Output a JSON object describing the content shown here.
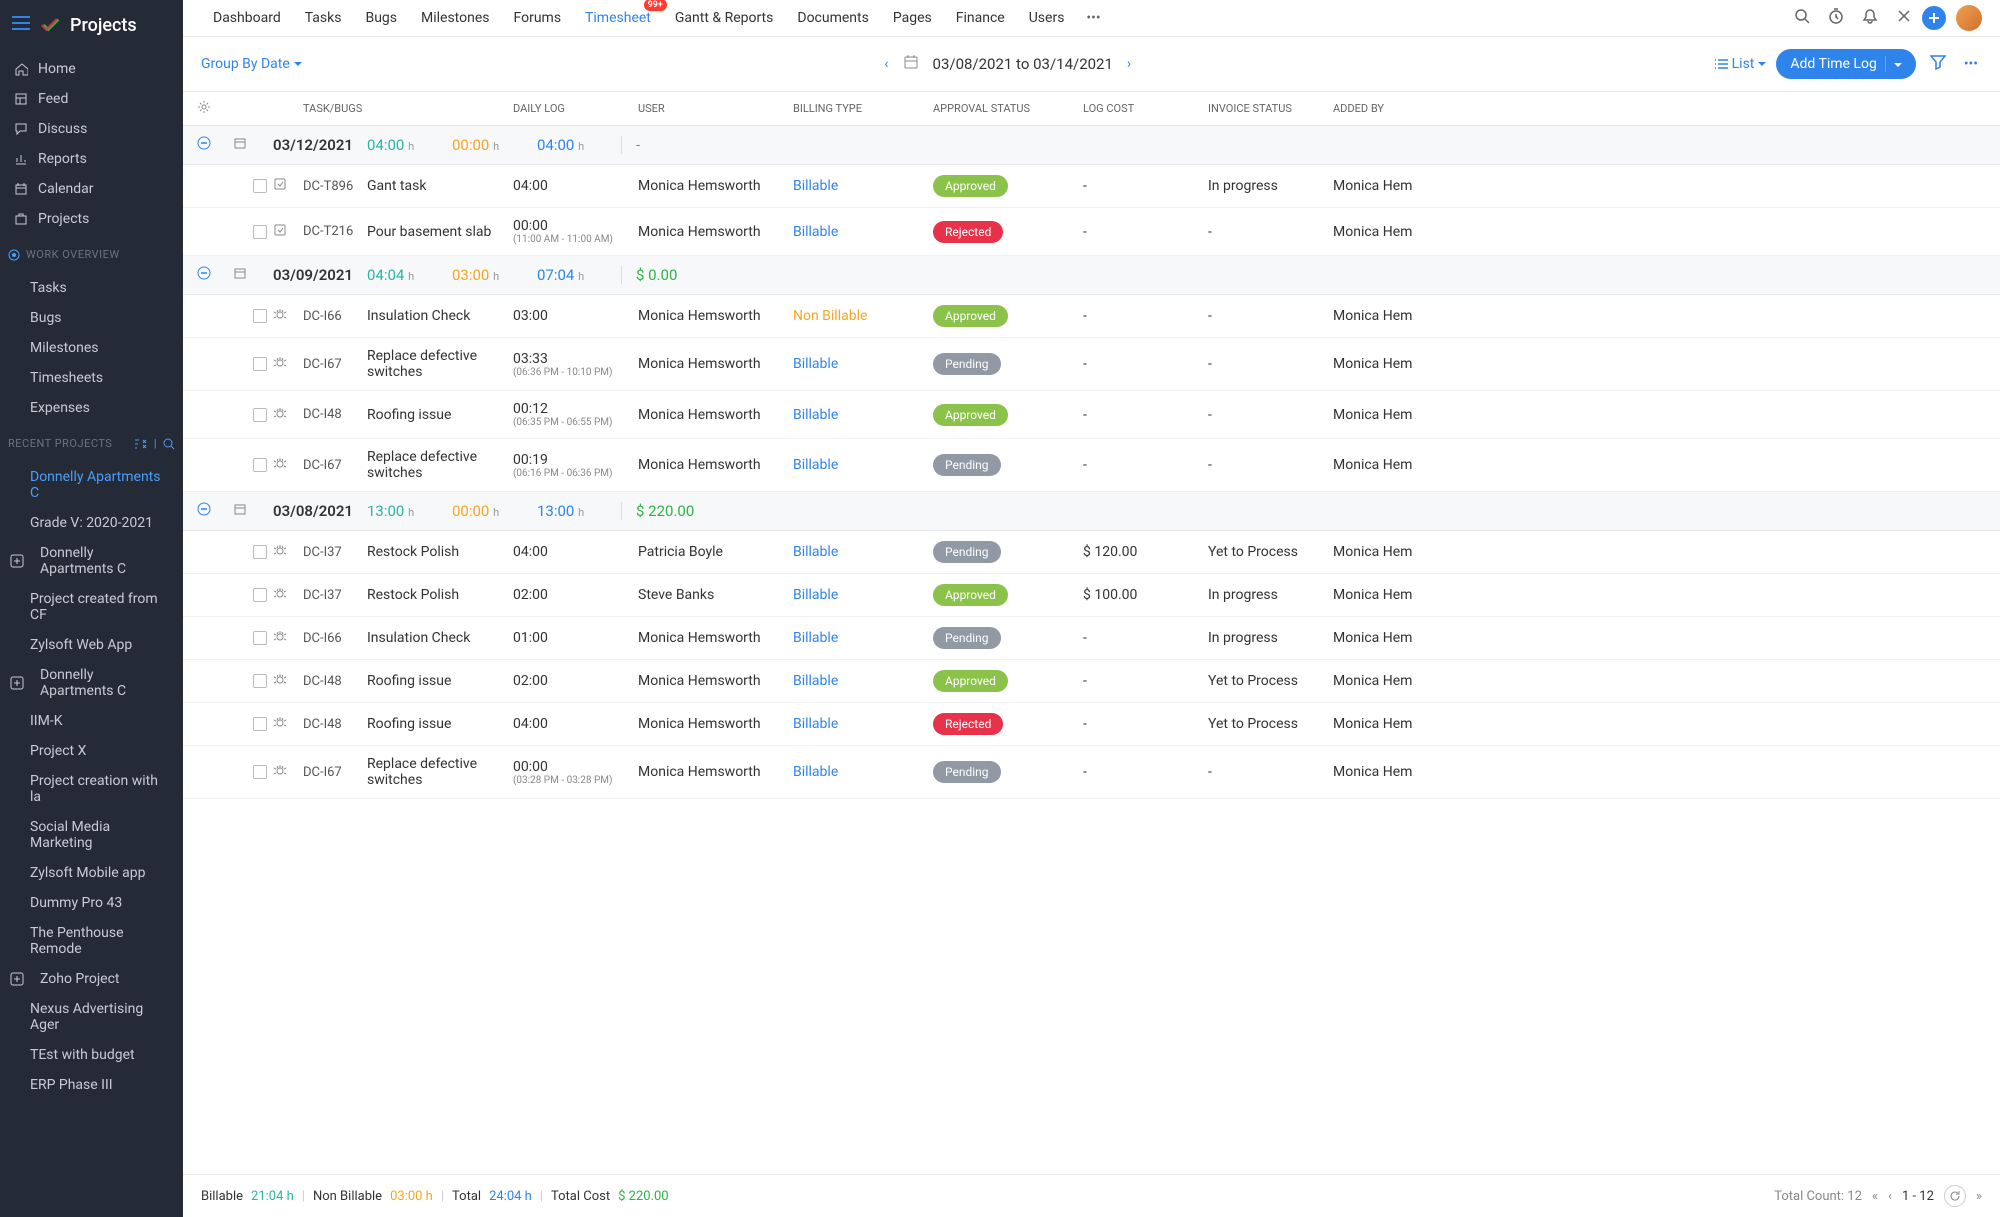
{
  "app_name": "Projects",
  "sidebar": {
    "main_items": [
      {
        "icon": "home",
        "label": "Home"
      },
      {
        "icon": "feed",
        "label": "Feed"
      },
      {
        "icon": "discuss",
        "label": "Discuss"
      },
      {
        "icon": "reports",
        "label": "Reports"
      },
      {
        "icon": "calendar",
        "label": "Calendar"
      },
      {
        "icon": "projects",
        "label": "Projects"
      }
    ],
    "work_overview_label": "WORK OVERVIEW",
    "work_items": [
      "Tasks",
      "Bugs",
      "Milestones",
      "Timesheets",
      "Expenses"
    ],
    "recent_projects_label": "RECENT PROJECTS",
    "recent_items": [
      {
        "label": "Donnelly Apartments C",
        "active": true
      },
      {
        "label": "Grade V: 2020-2021"
      },
      {
        "label": "Donnelly Apartments C",
        "icon": true
      },
      {
        "label": "Project created from CF"
      },
      {
        "label": "Zylsoft Web App"
      },
      {
        "label": "Donnelly Apartments C",
        "icon": true
      },
      {
        "label": "IIM-K"
      },
      {
        "label": "Project X"
      },
      {
        "label": "Project creation with la"
      },
      {
        "label": "Social Media Marketing"
      },
      {
        "label": "Zylsoft Mobile app"
      },
      {
        "label": "Dummy Pro 43"
      },
      {
        "label": "The Penthouse Remode"
      },
      {
        "label": "Zoho Project",
        "icon": true
      },
      {
        "label": "Nexus Advertising Ager"
      },
      {
        "label": "TEst with budget"
      },
      {
        "label": "ERP Phase III"
      }
    ]
  },
  "topbar": {
    "tabs": [
      "Dashboard",
      "Tasks",
      "Bugs",
      "Milestones",
      "Forums",
      "Timesheet",
      "Gantt & Reports",
      "Documents",
      "Pages",
      "Finance",
      "Users"
    ],
    "active": "Timesheet",
    "badge": "99+"
  },
  "toolbar": {
    "group_by": "Group By Date",
    "date_range": "03/08/2021 to 03/14/2021",
    "view_label": "List",
    "add_label": "Add Time Log"
  },
  "columns": [
    "TASK/BUGS",
    "DAILY LOG",
    "USER",
    "BILLING TYPE",
    "APPROVAL STATUS",
    "LOG COST",
    "INVOICE STATUS",
    "ADDED BY"
  ],
  "groups": [
    {
      "date": "03/12/2021",
      "h1": "04:00",
      "h2": "00:00",
      "h3": "04:00",
      "cost": "-",
      "rows": [
        {
          "type": "task",
          "id": "DC-T896",
          "name": "Gant task",
          "daily": "04:00",
          "user": "Monica Hemsworth",
          "billing": "Billable",
          "approval": "Approved",
          "logcost": "-",
          "invoice": "In progress",
          "added": "Monica Hem"
        },
        {
          "type": "task",
          "id": "DC-T216",
          "name": "Pour basement slab",
          "daily": "00:00",
          "span": "(11:00 AM - 11:00 AM)",
          "user": "Monica Hemsworth",
          "billing": "Billable",
          "approval": "Rejected",
          "logcost": "-",
          "invoice": "-",
          "added": "Monica Hem"
        }
      ]
    },
    {
      "date": "03/09/2021",
      "h1": "04:04",
      "h2": "03:00",
      "h3": "07:04",
      "cost": "$ 0.00",
      "rows": [
        {
          "type": "bug",
          "id": "DC-I66",
          "name": "Insulation Check",
          "daily": "03:00",
          "user": "Monica Hemsworth",
          "billing": "Non Billable",
          "approval": "Approved",
          "logcost": "-",
          "invoice": "-",
          "added": "Monica Hem"
        },
        {
          "type": "bug",
          "id": "DC-I67",
          "name": "Replace defective switches",
          "daily": "03:33",
          "span": "(06:36 PM - 10:10 PM)",
          "user": "Monica Hemsworth",
          "billing": "Billable",
          "approval": "Pending",
          "logcost": "-",
          "invoice": "-",
          "added": "Monica Hem"
        },
        {
          "type": "bug",
          "id": "DC-I48",
          "name": "Roofing issue",
          "daily": "00:12",
          "span": "(06:35 PM - 06:55 PM)",
          "user": "Monica Hemsworth",
          "billing": "Billable",
          "approval": "Approved",
          "logcost": "-",
          "invoice": "-",
          "added": "Monica Hem"
        },
        {
          "type": "bug",
          "id": "DC-I67",
          "name": "Replace defective switches",
          "daily": "00:19",
          "span": "(06:16 PM - 06:36 PM)",
          "user": "Monica Hemsworth",
          "billing": "Billable",
          "approval": "Pending",
          "logcost": "-",
          "invoice": "-",
          "added": "Monica Hem"
        }
      ]
    },
    {
      "date": "03/08/2021",
      "h1": "13:00",
      "h2": "00:00",
      "h3": "13:00",
      "cost": "$ 220.00",
      "rows": [
        {
          "type": "bug",
          "id": "DC-I37",
          "name": "Restock Polish",
          "daily": "04:00",
          "user": "Patricia Boyle",
          "billing": "Billable",
          "approval": "Pending",
          "logcost": "$ 120.00",
          "invoice": "Yet to Process",
          "added": "Monica Hem"
        },
        {
          "type": "bug",
          "id": "DC-I37",
          "name": "Restock Polish",
          "daily": "02:00",
          "user": "Steve Banks",
          "billing": "Billable",
          "approval": "Approved",
          "logcost": "$ 100.00",
          "invoice": "In progress",
          "added": "Monica Hem"
        },
        {
          "type": "bug",
          "id": "DC-I66",
          "name": "Insulation Check",
          "daily": "01:00",
          "user": "Monica Hemsworth",
          "billing": "Billable",
          "approval": "Pending",
          "logcost": "-",
          "invoice": "In progress",
          "added": "Monica Hem"
        },
        {
          "type": "bug",
          "id": "DC-I48",
          "name": "Roofing issue",
          "daily": "02:00",
          "user": "Monica Hemsworth",
          "billing": "Billable",
          "approval": "Approved",
          "logcost": "-",
          "invoice": "Yet to Process",
          "added": "Monica Hem"
        },
        {
          "type": "bug",
          "id": "DC-I48",
          "name": "Roofing issue",
          "daily": "04:00",
          "user": "Monica Hemsworth",
          "billing": "Billable",
          "approval": "Rejected",
          "logcost": "-",
          "invoice": "Yet to Process",
          "added": "Monica Hem"
        },
        {
          "type": "bug",
          "id": "DC-I67",
          "name": "Replace defective switches",
          "daily": "00:00",
          "span": "(03:28 PM - 03:28 PM)",
          "user": "Monica Hemsworth",
          "billing": "Billable",
          "approval": "Pending",
          "logcost": "-",
          "invoice": "-",
          "added": "Monica Hem"
        }
      ]
    }
  ],
  "footer": {
    "billable_label": "Billable",
    "billable_val": "21:04 h",
    "nonbillable_label": "Non Billable",
    "nonbillable_val": "03:00 h",
    "total_label": "Total",
    "total_val": "24:04 h",
    "totalcost_label": "Total Cost",
    "totalcost_val": "$ 220.00",
    "count_label": "Total Count: 12",
    "range": "1 - 12"
  }
}
